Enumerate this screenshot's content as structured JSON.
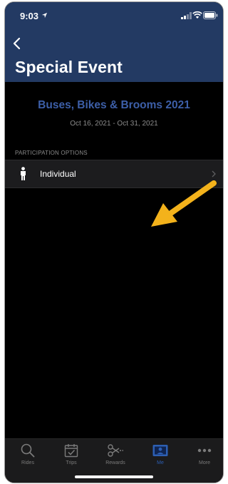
{
  "status_bar": {
    "time": "9:03"
  },
  "nav": {
    "title": "Special Event"
  },
  "event": {
    "name": "Buses, Bikes & Brooms 2021",
    "dates": "Oct 16, 2021 - Oct 31, 2021"
  },
  "participation": {
    "header": "PARTICIPATION OPTIONS",
    "options": [
      {
        "label": "Individual",
        "icon": "person-icon"
      }
    ]
  },
  "annotation": {
    "arrow_color": "#f3b21b"
  },
  "tabbar": {
    "tabs": [
      {
        "label": "Rides",
        "icon": "search-icon",
        "active": false
      },
      {
        "label": "Trips",
        "icon": "calendar-check-icon",
        "active": false
      },
      {
        "label": "Rewards",
        "icon": "scissors-coupon-icon",
        "active": false
      },
      {
        "label": "Me",
        "icon": "id-card-icon",
        "active": true
      },
      {
        "label": "More",
        "icon": "more-dots-icon",
        "active": false
      }
    ]
  },
  "colors": {
    "nav_background": "#233a63",
    "accent": "#2d5fb3",
    "event_title": "#3d5fa8"
  }
}
